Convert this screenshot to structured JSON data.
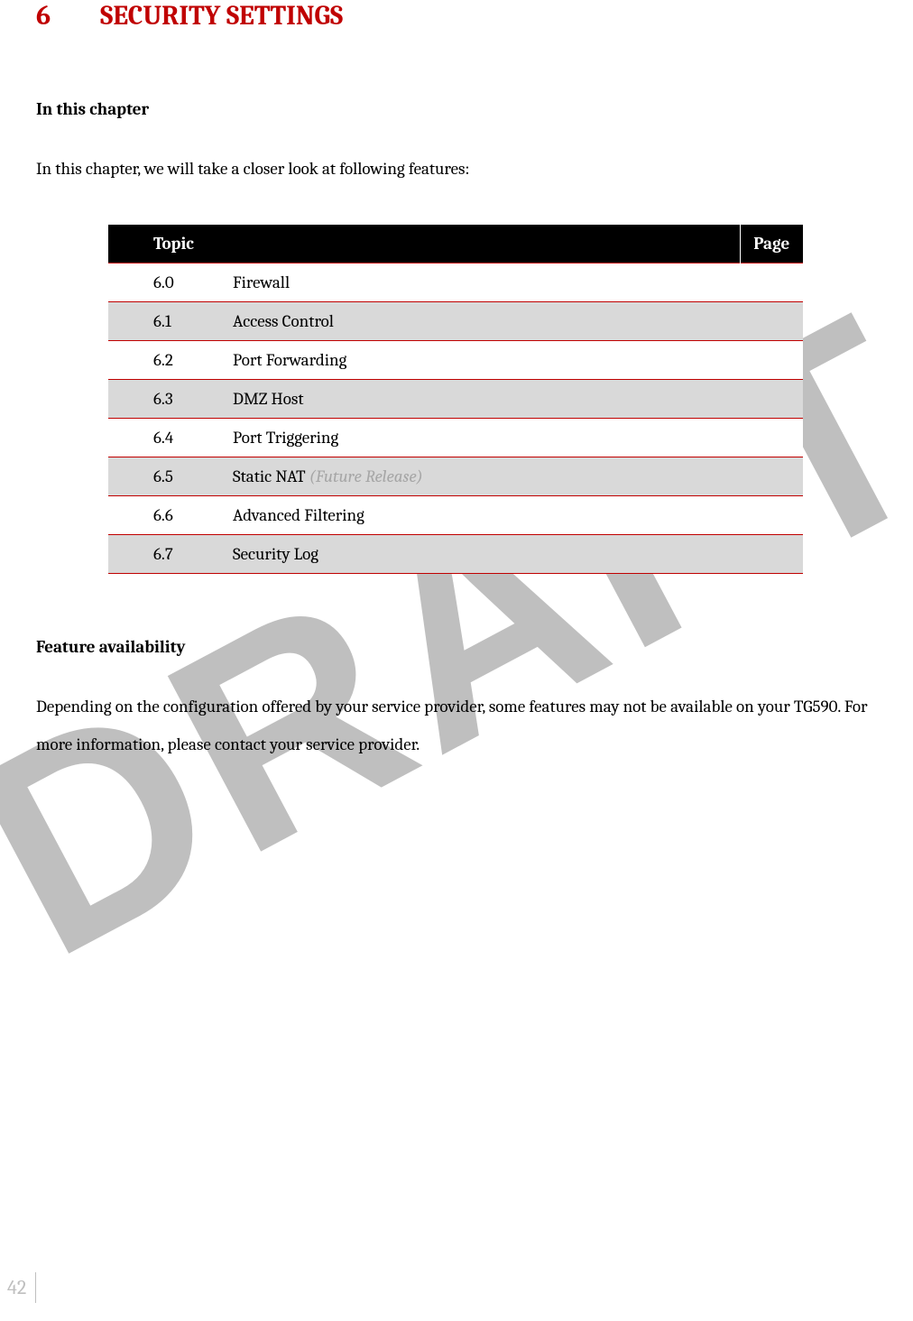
{
  "watermark": "DRAFT",
  "chapter": {
    "number": "6",
    "title": "SECURITY SETTINGS"
  },
  "section1": {
    "heading": "In this chapter",
    "intro": "In this chapter, we will take a closer look at following features:"
  },
  "toc": {
    "header_topic": "Topic",
    "header_page": "Page",
    "rows": [
      {
        "num": "6.0",
        "title": "Firewall",
        "note": "",
        "page": ""
      },
      {
        "num": "6.1",
        "title": "Access Control",
        "note": "",
        "page": ""
      },
      {
        "num": "6.2",
        "title": "Port Forwarding",
        "note": "",
        "page": ""
      },
      {
        "num": "6.3",
        "title": "DMZ Host",
        "note": "",
        "page": ""
      },
      {
        "num": "6.4",
        "title": "Port Triggering",
        "note": "",
        "page": ""
      },
      {
        "num": "6.5",
        "title": "Static NAT ",
        "note": "(Future Release)",
        "page": ""
      },
      {
        "num": "6.6",
        "title": "Advanced Filtering",
        "note": "",
        "page": ""
      },
      {
        "num": "6.7",
        "title": "Security Log",
        "note": "",
        "page": ""
      }
    ]
  },
  "section2": {
    "heading": "Feature availability",
    "body": "Depending on the configuration offered by your service provider, some features may not be available on your TG590. For more information, please contact your service provider."
  },
  "page_number": "42"
}
